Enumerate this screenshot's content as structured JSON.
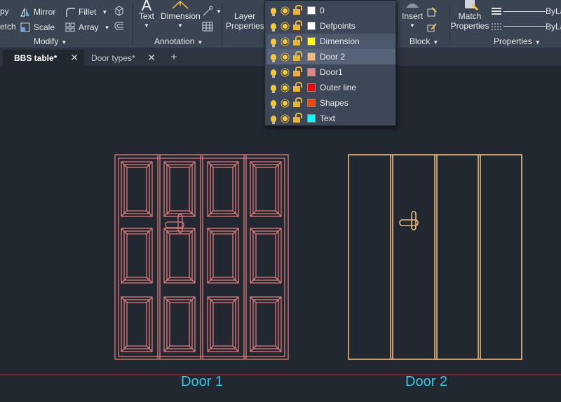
{
  "ribbon": {
    "modify": {
      "copy_label": "py",
      "stretch_label": "etch",
      "mirror_label": "Mirror",
      "scale_label": "Scale",
      "fillet_label": "Fillet",
      "array_label": "Array",
      "panel_title": "Modify"
    },
    "annotation": {
      "text_label": "Text",
      "dimension_label": "Dimension",
      "panel_title": "Annotation"
    },
    "layers": {
      "layer_properties_line1": "Layer",
      "layer_properties_line2": "Properties"
    },
    "block": {
      "insert_label": "Insert",
      "panel_title": "Block"
    },
    "properties": {
      "match_line1": "Match",
      "match_line2": "Properties",
      "bylayer_1": "ByLa",
      "bylayer_2": "ByLa",
      "panel_title": "Properties"
    }
  },
  "tabs": [
    {
      "label": "BBS table*",
      "active": true
    },
    {
      "label": "Door types*",
      "active": false
    }
  ],
  "tab_add_label": "+",
  "layers_dropdown": [
    {
      "name": "0",
      "color": "#ffffff"
    },
    {
      "name": "Defpoints",
      "color": "#ffffff"
    },
    {
      "name": "Dimension",
      "color": "#ffff00"
    },
    {
      "name": "Door 2",
      "color": "#f5b97a"
    },
    {
      "name": "Door1",
      "color": "#f08080"
    },
    {
      "name": "Outer line",
      "color": "#ff0000"
    },
    {
      "name": "Shapes",
      "color": "#ff4500"
    },
    {
      "name": "Text",
      "color": "#00ffff"
    }
  ],
  "canvas": {
    "door1_label": "Door 1",
    "door2_label": "Door 2",
    "door1_color": "#e07a7a",
    "door2_color": "#f0b878",
    "outer_line_color": "#b01e1e",
    "label_color": "#2ec8e8"
  },
  "colors": {
    "ribbon_bg": "#3b4453",
    "canvas_bg": "#212830",
    "accent_lock": "#e8b43a"
  }
}
